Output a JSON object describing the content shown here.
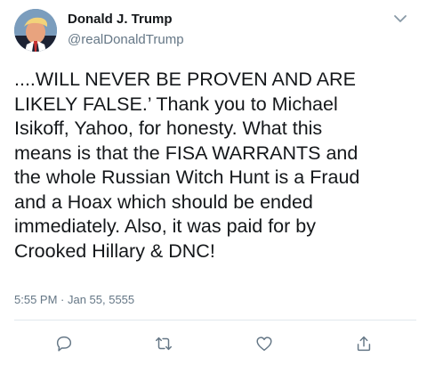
{
  "tweet": {
    "author_name": "Donald J. Trump",
    "handle": "@realDonaldTrump",
    "text": "....WILL NEVER BE PROVEN AND ARE\nLIKELY FALSE.’ Thank you to Michael\nIsikoff, Yahoo, for honesty. What this\nmeans is that the FISA WARRANTS and\nthe whole Russian Witch Hunt is a Fraud\nand a Hoax which should be ended\nimmediately. Also, it was paid for by\nCrooked Hillary & DNC!",
    "timestamp": "5:55 PM · Jan 55, 5555"
  },
  "icons": {
    "menu": "chevron-down-icon",
    "reply": "reply-icon",
    "retweet": "retweet-icon",
    "like": "like-icon",
    "share": "share-icon"
  },
  "colors": {
    "text": "#14171a",
    "secondary": "#657786",
    "divider": "#e1e8ed",
    "background": "#ffffff"
  }
}
